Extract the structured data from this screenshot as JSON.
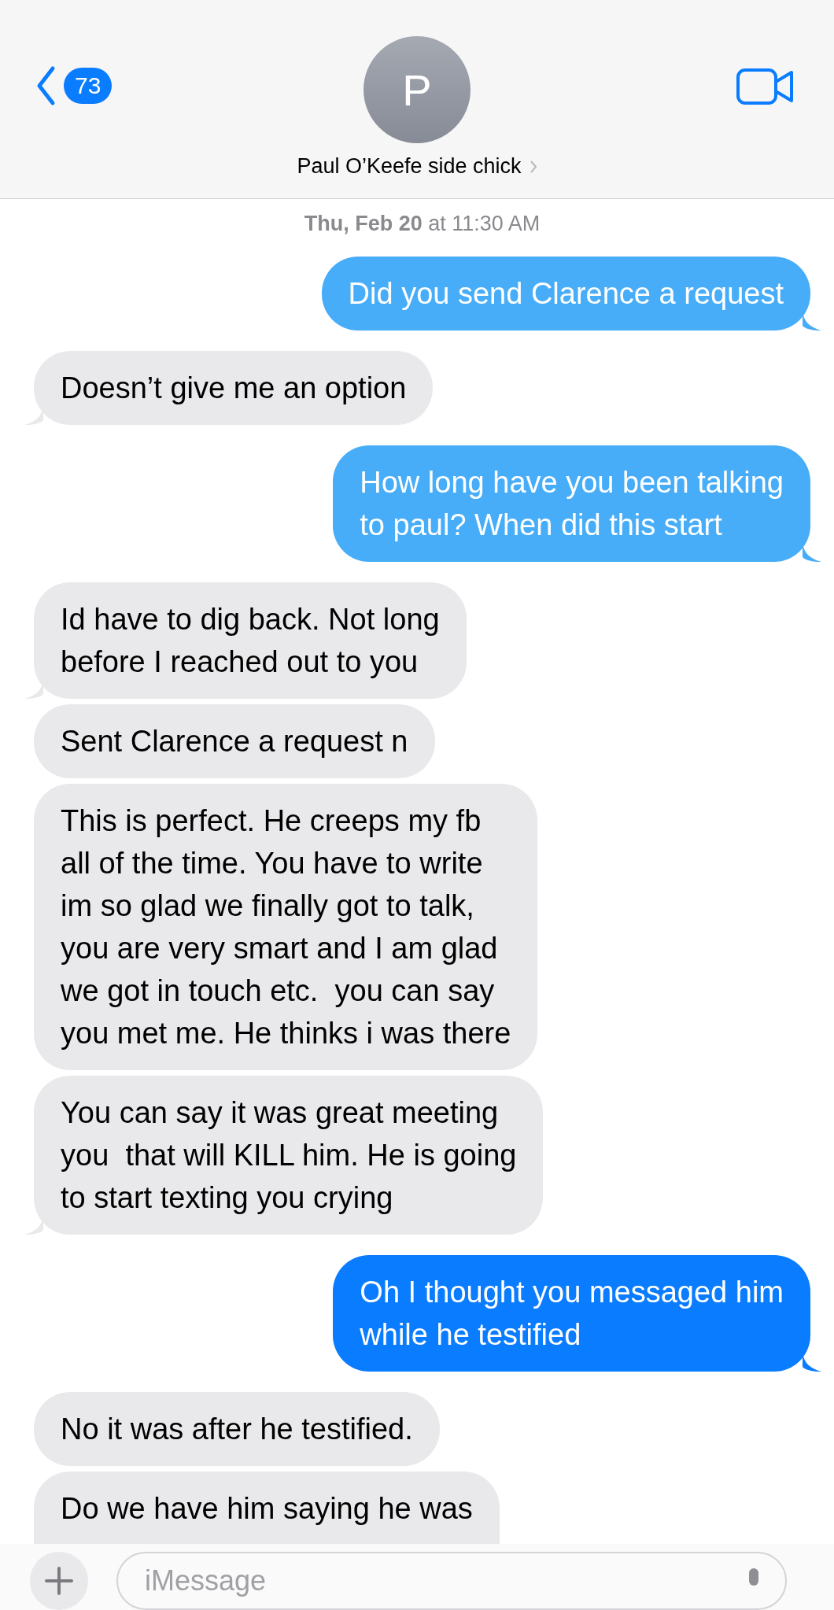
{
  "header": {
    "back_badge": "73",
    "avatar_initial": "P",
    "contact_name": "Paul O’Keefe side chick"
  },
  "timestamp": {
    "day": "Thu, Feb 20",
    "time": "at 11:30 AM"
  },
  "messages": [
    {
      "kind": "sent",
      "text": "Did you send Clarence a request",
      "color": "#47adf8",
      "tail": true
    },
    {
      "kind": "received",
      "text": "Doesn’t give me an option",
      "tail": true
    },
    {
      "kind": "sent",
      "text": "How long have you been talking\nto paul? When did this start",
      "color": "#47adf8",
      "tail": true
    },
    {
      "kind": "received",
      "text": "Id have to dig back. Not long\nbefore I reached out to you",
      "tail": true
    },
    {
      "kind": "received",
      "text": "Sent Clarence a request n",
      "tail": false
    },
    {
      "kind": "received",
      "text": "This is perfect. He creeps my fb\nall of the time. You have to write\nim so glad we finally got to talk,\nyou are very smart and I am glad\nwe got in touch etc.  you can say\nyou met me. He thinks i was there",
      "tail": false
    },
    {
      "kind": "received",
      "text": "You can say it was great meeting\nyou  that will KILL him. He is going\nto start texting you crying",
      "tail": true
    },
    {
      "kind": "sent",
      "text": "Oh I thought you messaged him\nwhile he testified",
      "color": "#0a7cff",
      "tail": true
    },
    {
      "kind": "received",
      "text": "No it was after he testified.",
      "tail": false
    },
    {
      "kind": "received",
      "text": "Do we have him saying he was"
    }
  ],
  "composer": {
    "placeholder": "iMessage"
  }
}
